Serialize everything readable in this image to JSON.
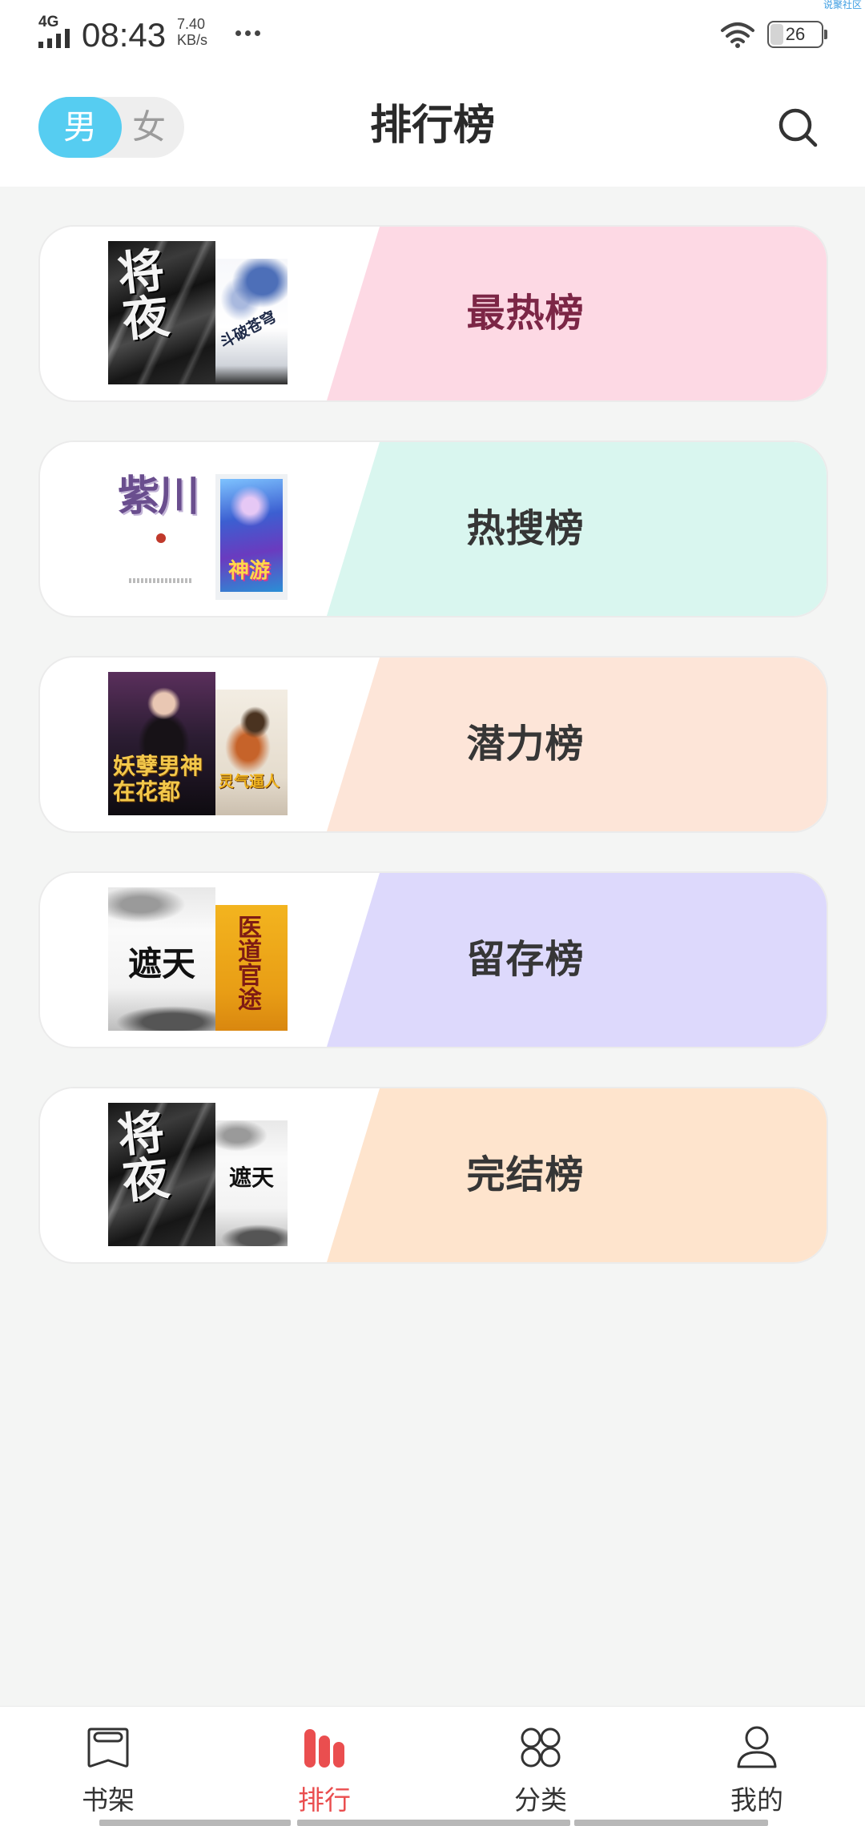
{
  "status_bar": {
    "network": "4G",
    "time": "08:43",
    "speed_value": "7.40",
    "speed_unit": "KB/s",
    "battery_percent": "26",
    "battery_level": 0.26,
    "watermark": "说聚社区",
    "icons": [
      "cellular-signal-icon",
      "more-dots-icon",
      "wifi-icon",
      "battery-icon"
    ]
  },
  "header": {
    "gender_toggle": [
      {
        "label": "男",
        "selected": true
      },
      {
        "label": "女",
        "selected": false
      }
    ],
    "title": "排行榜",
    "search_icon": "search-icon",
    "accent_color": "#56cdf1"
  },
  "rankings": [
    {
      "label": "最热榜",
      "band_color": "#fdd9e4",
      "text_color": "#7c2646",
      "covers": [
        {
          "title": "将夜"
        },
        {
          "title": "斗破苍穹"
        }
      ]
    },
    {
      "label": "热搜榜",
      "band_color": "#d9f6ef",
      "text_color": "#363636",
      "covers": [
        {
          "title": "紫川"
        },
        {
          "title": "神游"
        }
      ]
    },
    {
      "label": "潜力榜",
      "band_color": "#fde5d8",
      "text_color": "#363636",
      "covers": [
        {
          "title": "妖孽男神在花都"
        },
        {
          "title": "灵气逼人"
        }
      ]
    },
    {
      "label": "留存榜",
      "band_color": "#ddd9fc",
      "text_color": "#363636",
      "covers": [
        {
          "title": "遮天"
        },
        {
          "title": "医道官途"
        }
      ]
    },
    {
      "label": "完结榜",
      "band_color": "#fee4cd",
      "text_color": "#363636",
      "covers": [
        {
          "title": "将夜"
        },
        {
          "title": "遮天"
        }
      ]
    }
  ],
  "bottom_nav": {
    "active_color": "#ea4e4f",
    "inactive_color": "#333333",
    "items": [
      {
        "label": "书架",
        "icon": "bookshelf-icon",
        "active": false
      },
      {
        "label": "排行",
        "icon": "ranking-bars-icon",
        "active": true
      },
      {
        "label": "分类",
        "icon": "category-grid-icon",
        "active": false
      },
      {
        "label": "我的",
        "icon": "profile-icon",
        "active": false
      }
    ]
  }
}
